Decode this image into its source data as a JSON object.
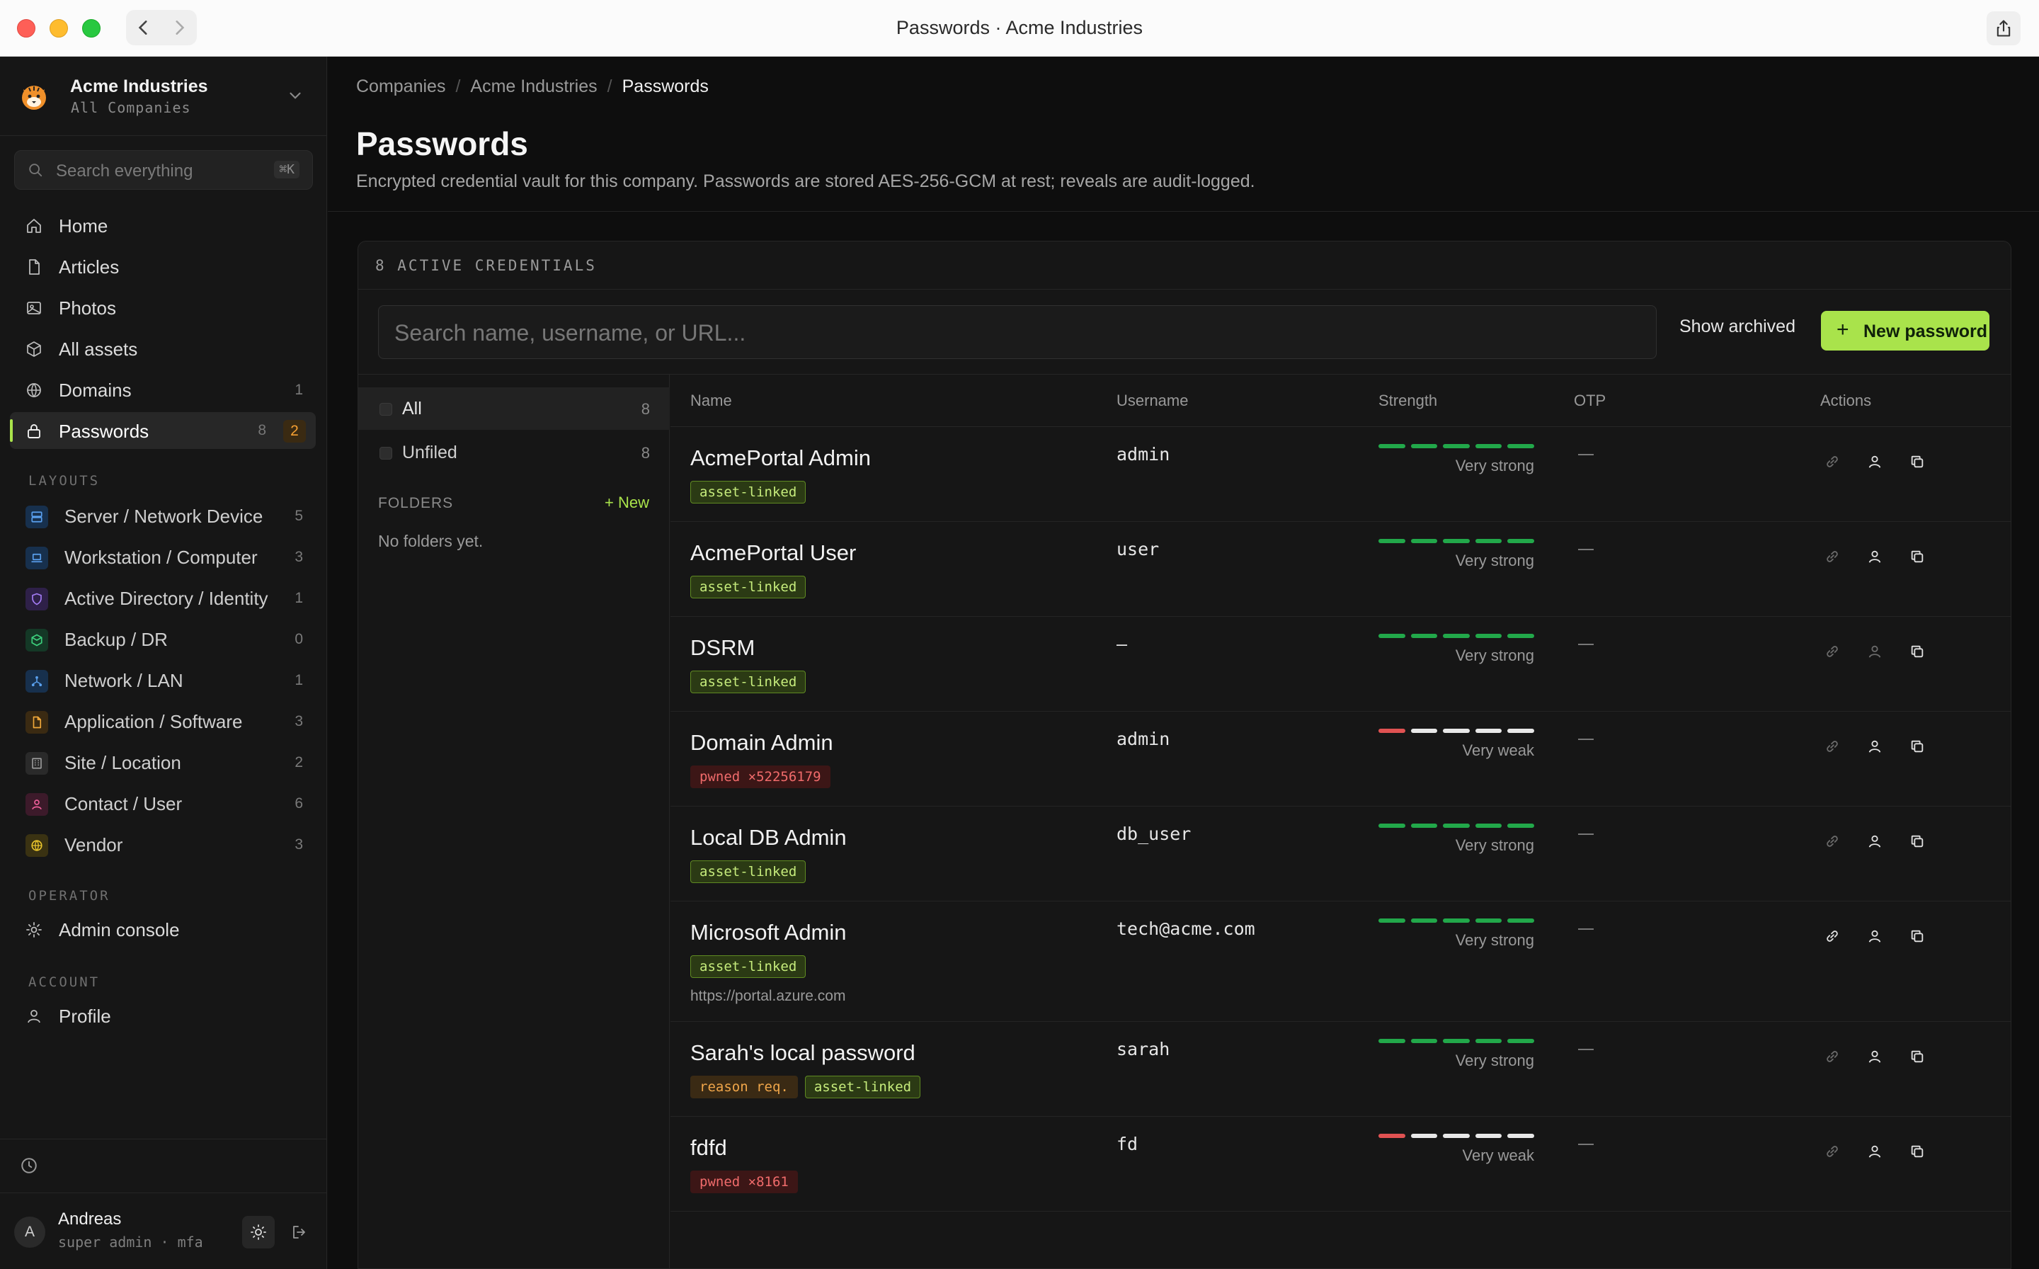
{
  "window": {
    "title": "Passwords · Acme Industries"
  },
  "workspace": {
    "name": "Acme Industries",
    "subtitle": "All Companies"
  },
  "sidebar": {
    "search_placeholder": "Search everything",
    "search_shortcut": "⌘K",
    "nav": [
      {
        "label": "Home",
        "icon": "home-icon"
      },
      {
        "label": "Articles",
        "icon": "document-icon"
      },
      {
        "label": "Photos",
        "icon": "image-icon"
      },
      {
        "label": "All assets",
        "icon": "cube-icon"
      },
      {
        "label": "Domains",
        "icon": "globe-icon",
        "count": "1"
      },
      {
        "label": "Passwords",
        "icon": "lock-icon",
        "count": "8",
        "badge": "2",
        "active": true
      }
    ],
    "layouts_header": "LAYOUTS",
    "layouts": [
      {
        "label": "Server / Network Device",
        "count": "5",
        "color": "#4a90d9",
        "icon": "server-icon"
      },
      {
        "label": "Workstation / Computer",
        "count": "3",
        "color": "#4a90d9",
        "icon": "laptop-icon"
      },
      {
        "label": "Active Directory / Identity",
        "count": "1",
        "color": "#9b6cf0",
        "icon": "shield-icon"
      },
      {
        "label": "Backup / DR",
        "count": "0",
        "color": "#2fbf71",
        "icon": "box-icon"
      },
      {
        "label": "Network / LAN",
        "count": "1",
        "color": "#4a90d9",
        "icon": "network-icon"
      },
      {
        "label": "Application / Software",
        "count": "3",
        "color": "#f0a83a",
        "icon": "file-icon"
      },
      {
        "label": "Site / Location",
        "count": "2",
        "color": "#8a8a8a",
        "icon": "building-icon"
      },
      {
        "label": "Contact / User",
        "count": "6",
        "color": "#e0508a",
        "icon": "user-icon"
      },
      {
        "label": "Vendor",
        "count": "3",
        "color": "#e8c020",
        "icon": "globe-icon"
      }
    ],
    "operator_header": "OPERATOR",
    "admin_label": "Admin console",
    "account_header": "ACCOUNT",
    "profile_label": "Profile",
    "user": {
      "initial": "A",
      "name": "Andreas",
      "role": "super admin · mfa"
    }
  },
  "breadcrumbs": [
    "Companies",
    "Acme Industries",
    "Passwords"
  ],
  "page": {
    "title": "Passwords",
    "description": "Encrypted credential vault for this company. Passwords are stored AES-256-GCM at rest; reveals are audit-logged."
  },
  "vault": {
    "header": "8 ACTIVE CREDENTIALS",
    "search_placeholder": "Search name, username, or URL...",
    "show_archived": "Show archived",
    "new_password": "New password"
  },
  "folders": {
    "items": [
      {
        "label": "All",
        "count": "8"
      },
      {
        "label": "Unfiled",
        "count": "8"
      }
    ],
    "header": "FOLDERS",
    "new_label": "+ New",
    "empty": "No folders yet."
  },
  "columns": {
    "name": "Name",
    "username": "Username",
    "strength": "Strength",
    "otp": "OTP",
    "actions": "Actions"
  },
  "colors": {
    "accent": "#a9e34b",
    "strong": "#22a84a",
    "weak": "#e05252",
    "empty": "#e8e8e8"
  },
  "credentials": [
    {
      "name": "AcmePortal Admin",
      "tags": [
        {
          "type": "linked",
          "text": "asset-linked"
        }
      ],
      "username": "admin",
      "strength_filled": 5,
      "strength_label": "Very strong",
      "otp": "—"
    },
    {
      "name": "AcmePortal User",
      "tags": [
        {
          "type": "linked",
          "text": "asset-linked"
        }
      ],
      "username": "user",
      "strength_filled": 5,
      "strength_label": "Very strong",
      "otp": "—"
    },
    {
      "name": "DSRM",
      "tags": [
        {
          "type": "linked",
          "text": "asset-linked"
        }
      ],
      "username": "—",
      "strength_filled": 5,
      "strength_label": "Very strong",
      "otp": "—"
    },
    {
      "name": "Domain Admin",
      "tags": [
        {
          "type": "pwned",
          "text": "pwned ×52256179"
        }
      ],
      "username": "admin",
      "strength_filled": 1,
      "strength_label": "Very weak",
      "otp": "—"
    },
    {
      "name": "Local DB Admin",
      "tags": [
        {
          "type": "linked",
          "text": "asset-linked"
        }
      ],
      "username": "db_user",
      "strength_filled": 5,
      "strength_label": "Very strong",
      "otp": "—"
    },
    {
      "name": "Microsoft Admin",
      "tags": [
        {
          "type": "linked",
          "text": "asset-linked"
        }
      ],
      "url": "https://portal.azure.com",
      "username": "tech@acme.com",
      "strength_filled": 5,
      "strength_label": "Very strong",
      "otp": "—"
    },
    {
      "name": "Sarah's local password",
      "tags": [
        {
          "type": "reason",
          "text": "reason req."
        },
        {
          "type": "linked",
          "text": "asset-linked"
        }
      ],
      "username": "sarah",
      "strength_filled": 5,
      "strength_label": "Very strong",
      "otp": "—"
    },
    {
      "name": "fdfd",
      "tags": [
        {
          "type": "pwned",
          "text": "pwned ×8161"
        }
      ],
      "username": "fd",
      "strength_filled": 1,
      "strength_label": "Very weak",
      "otp": "—"
    }
  ]
}
